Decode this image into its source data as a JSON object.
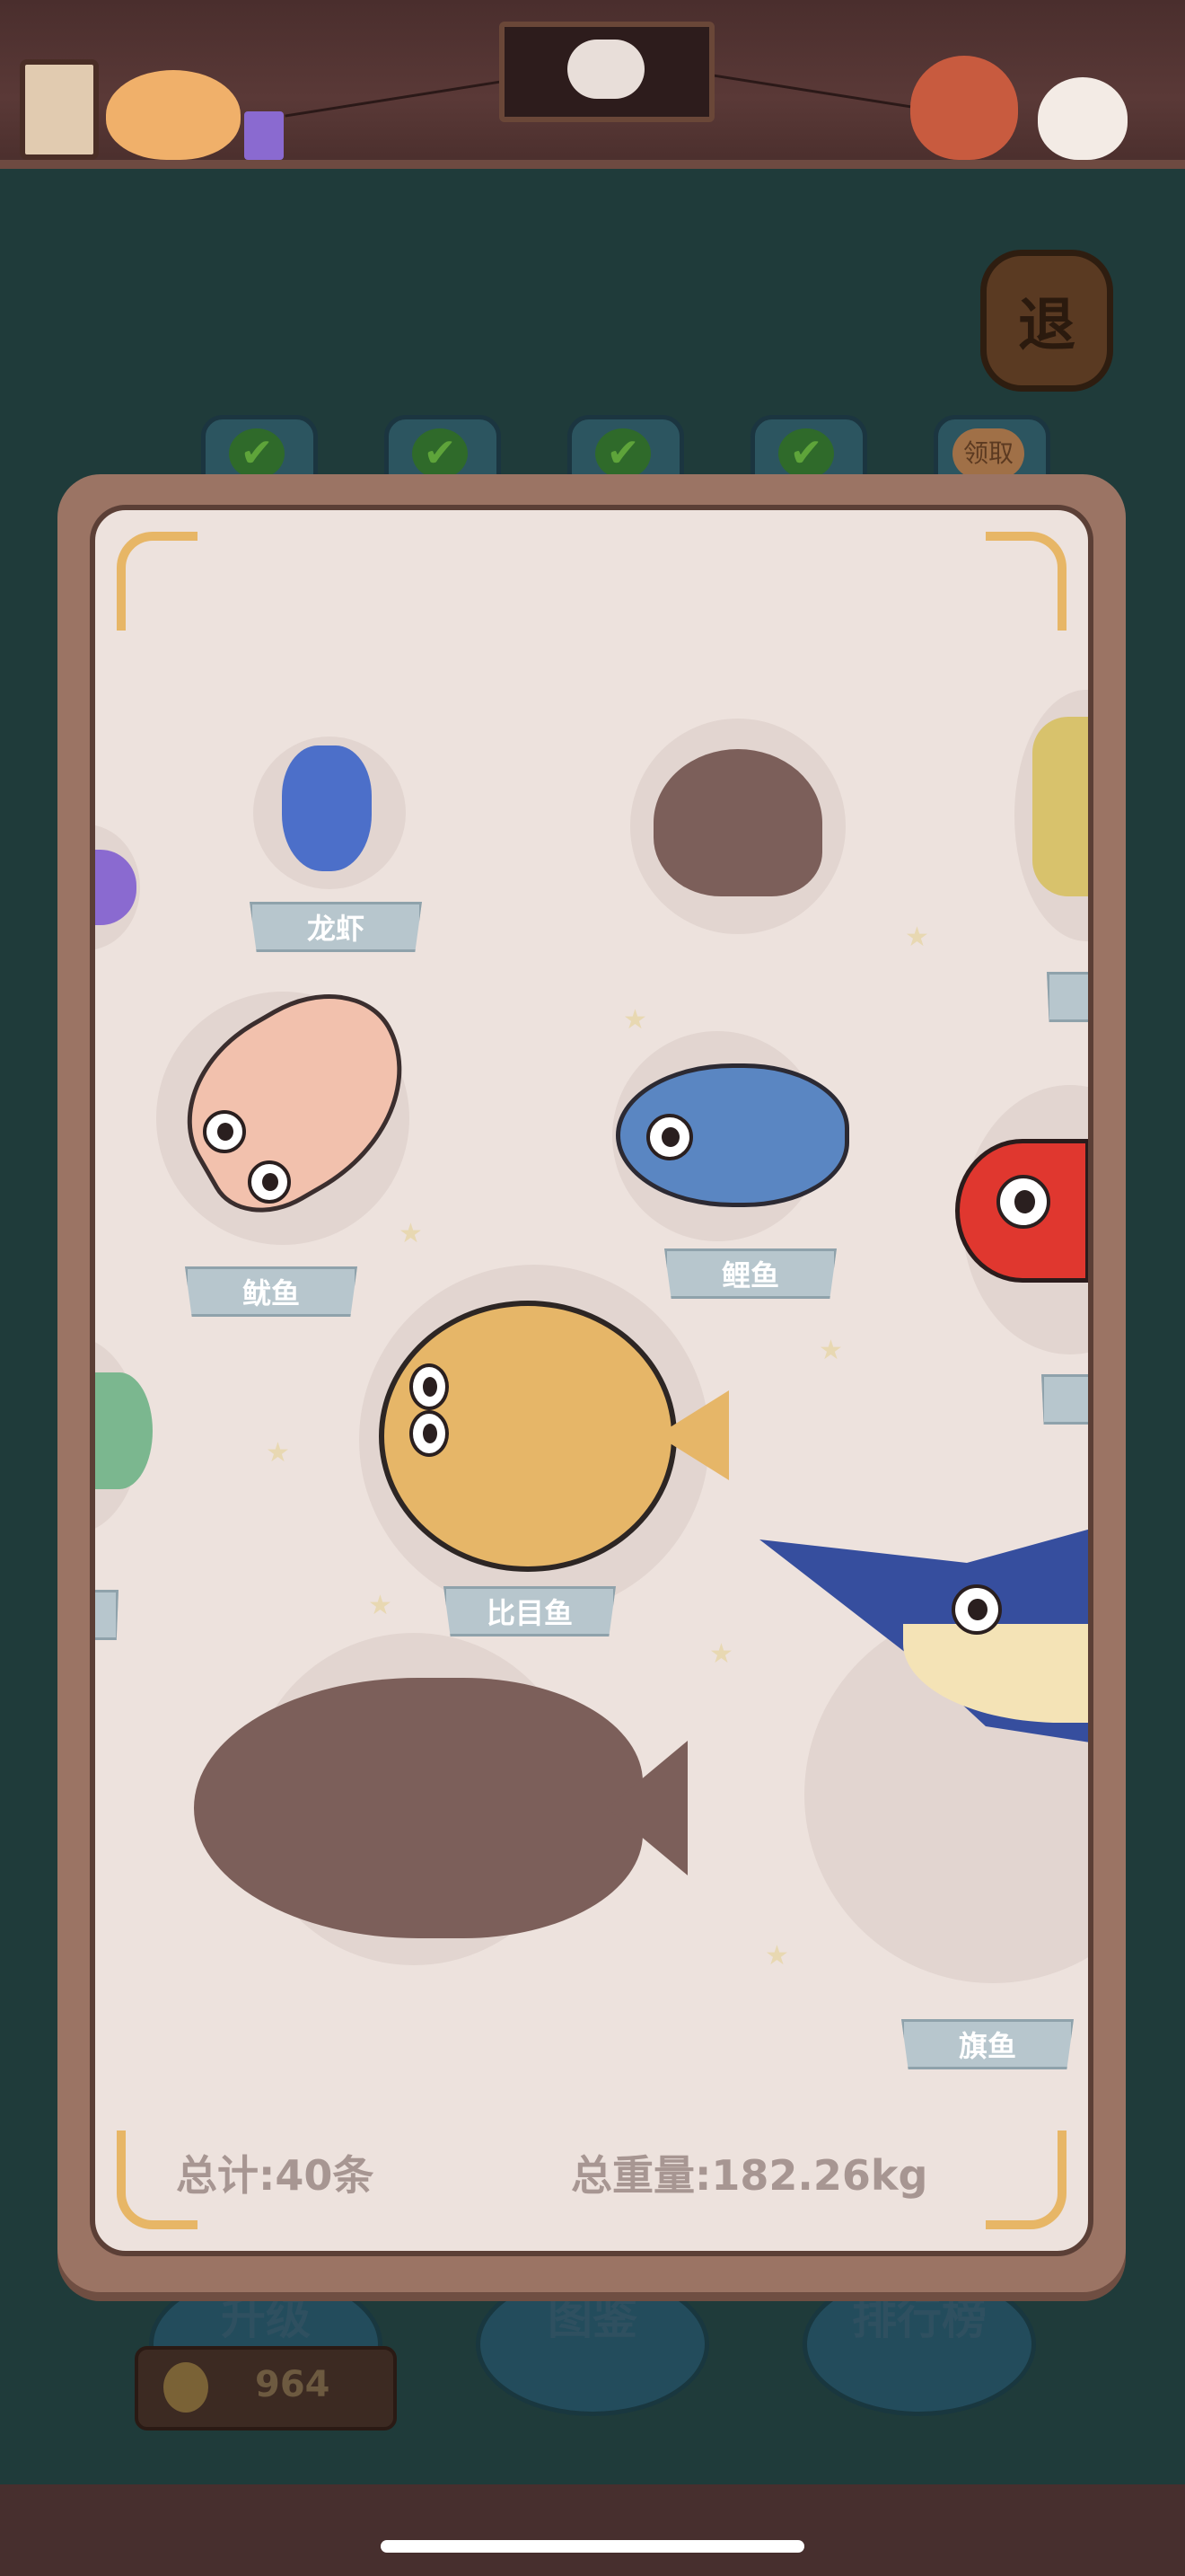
{
  "header": {
    "exit_button": "退",
    "claim_tab": "领取"
  },
  "collection": {
    "items": [
      {
        "name": "龙虾",
        "discovered": true
      },
      {
        "name": "",
        "discovered": false
      },
      {
        "name": "鱿鱼",
        "discovered": true
      },
      {
        "name": "鲤鱼",
        "discovered": true
      },
      {
        "name": "比目鱼",
        "discovered": true
      },
      {
        "name": "",
        "discovered": false
      },
      {
        "name": "旗鱼",
        "discovered": true
      }
    ]
  },
  "footer": {
    "total_count": "总计:40条",
    "total_weight": "总重量:182.26kg"
  },
  "bottom_nav": {
    "upgrade": "升级",
    "atlas": "图鉴",
    "leaderboard": "排行榜",
    "coins": "964"
  },
  "colors": {
    "panel_bg": "#ede2dd",
    "panel_border": "#9b7464",
    "label_bg": "#b7c6cd",
    "accent_gold": "#e7b666"
  }
}
